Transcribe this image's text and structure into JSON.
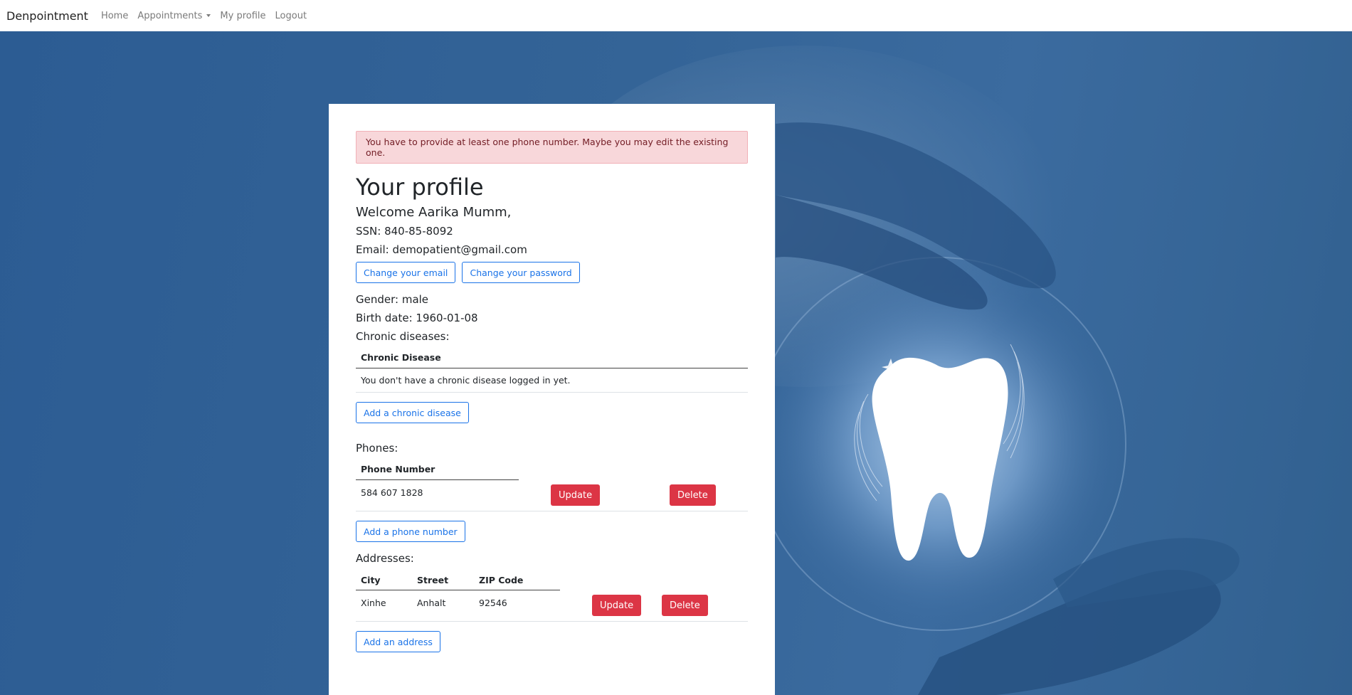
{
  "nav": {
    "brand": "Denpointment",
    "links": [
      "Home",
      "Appointments",
      "My profile",
      "Logout"
    ]
  },
  "alert": {
    "text": "You have to provide at least one phone number. Maybe you may edit the existing one."
  },
  "profile": {
    "title": "Your profile",
    "welcome": "Welcome Aarika Mumm,",
    "ssn": "SSN: 840-85-8092",
    "email": "Email: demopatient@gmail.com",
    "change_email": "Change your email",
    "change_password": "Change your password",
    "gender": "Gender: male",
    "birth_date": "Birth date: 1960-01-08"
  },
  "chronic": {
    "label": "Chronic diseases:",
    "header": "Chronic Disease",
    "empty": "You don't have a chronic disease logged in yet.",
    "add": "Add a chronic disease"
  },
  "phones": {
    "label": "Phones:",
    "header": "Phone Number",
    "rows": [
      {
        "number": "584 607 1828"
      }
    ],
    "update": "Update",
    "delete": "Delete",
    "add": "Add a phone number"
  },
  "addresses": {
    "label": "Addresses:",
    "headers": [
      "City",
      "Street",
      "ZIP Code"
    ],
    "rows": [
      {
        "city": "Xinhe",
        "street": "Anhalt",
        "zip": "92546"
      }
    ],
    "update": "Update",
    "delete": "Delete",
    "add": "Add an address"
  },
  "colors": {
    "background": "#2f5e94",
    "alert_bg": "#f8d7da",
    "primary": "#1a73e8",
    "danger": "#dc3545"
  }
}
